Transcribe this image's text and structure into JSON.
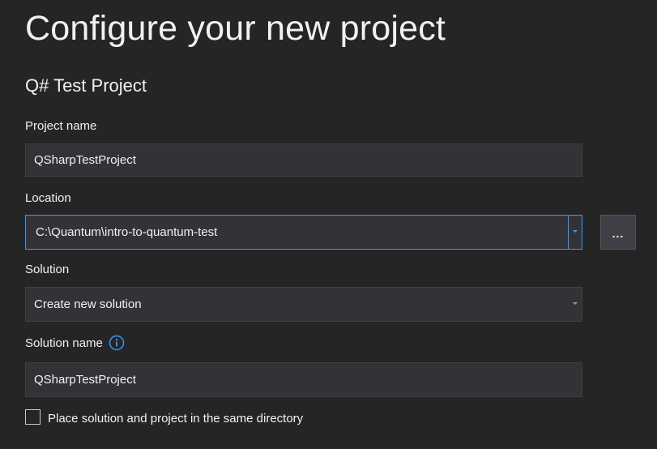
{
  "page": {
    "title": "Configure your new project",
    "template_name": "Q# Test Project"
  },
  "project_name": {
    "label": "Project name",
    "value": "QSharpTestProject"
  },
  "location": {
    "label": "Location",
    "value": "C:\\Quantum\\intro-to-quantum-test",
    "browse_label": "..."
  },
  "solution": {
    "label": "Solution",
    "selected": "Create new solution"
  },
  "solution_name": {
    "label": "Solution name",
    "value": "QSharpTestProject",
    "info_icon": "info-icon"
  },
  "same_directory": {
    "label": "Place solution and project in the same directory",
    "checked": false
  },
  "colors": {
    "background": "#252526",
    "field": "#333337",
    "accent": "#3399ff"
  }
}
